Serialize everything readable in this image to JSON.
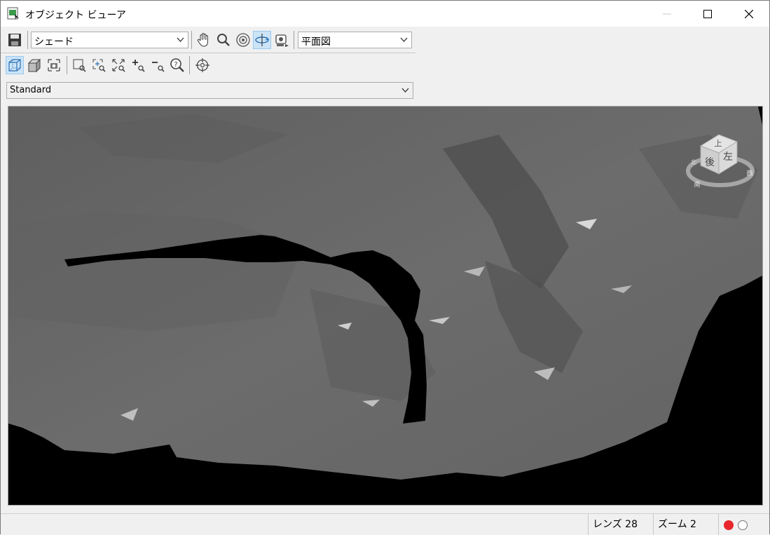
{
  "window": {
    "title": "オブジェクト ビューア"
  },
  "toolbar1": {
    "display_mode": "シェード",
    "view": "平面図",
    "icons": [
      "save-icon",
      "pan-hand-icon",
      "zoom-icon",
      "orbit-center-icon",
      "orbit-icon",
      "camera-icon"
    ]
  },
  "toolbar2": {
    "icons": [
      "wireframe-cube-icon",
      "solid-cube-icon",
      "camera-capture-icon",
      "zoom-window-icon",
      "zoom-extents-icon",
      "fit-all-icon",
      "zoom-in-icon",
      "zoom-out-icon",
      "zoom-question-icon",
      "target-icon"
    ]
  },
  "style_select": {
    "value": "Standard"
  },
  "viewcube": {
    "top": "上",
    "front": "後",
    "side": "左",
    "ring_left": "南",
    "ring_right": "西",
    "ring_top": "北"
  },
  "statusbar": {
    "lens": "レンズ 28",
    "zoom": "ズーム 2"
  },
  "colors": {
    "mesh": "#6a6a6a",
    "light_on": "#e8262c"
  }
}
